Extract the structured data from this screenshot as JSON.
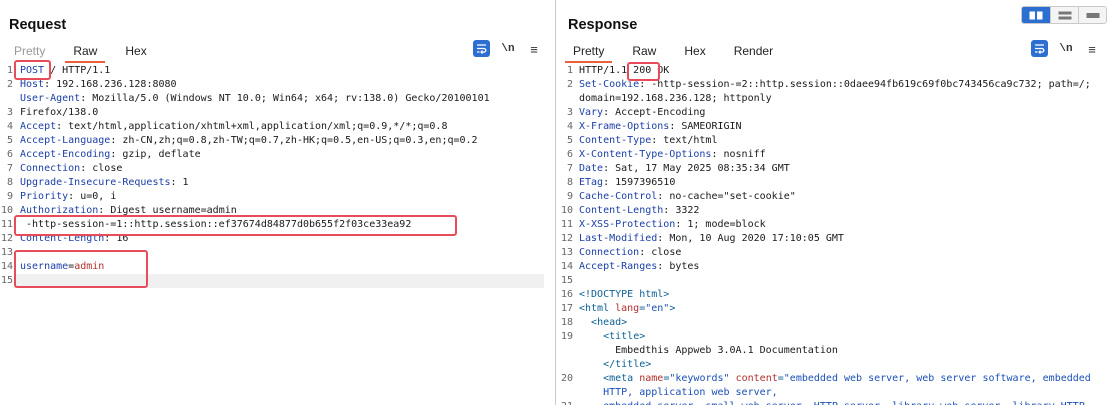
{
  "request": {
    "title": "Request",
    "tabs": [
      "Pretty",
      "Raw",
      "Hex"
    ],
    "active_tab": "Raw",
    "toolbar": {
      "wrap_icon": "wrap-lines-icon",
      "newline_label": "\\n",
      "menu_label": "≡"
    },
    "lines": [
      [
        [
          "k",
          "POST"
        ],
        [
          "v",
          " / HTTP/1.1"
        ]
      ],
      [
        [
          "k",
          "Host"
        ],
        [
          "v",
          ": 192.168.236.128:8080"
        ]
      ],
      [
        [
          "k",
          "User-Agent"
        ],
        [
          "v",
          ": Mozilla/5.0 (Windows NT 10.0; Win64; x64; rv:138.0) Gecko/20100101"
        ]
      ],
      [
        [
          "v",
          "Firefox/138.0"
        ]
      ],
      [
        [
          "k",
          "Accept"
        ],
        [
          "v",
          ": text/html,application/xhtml+xml,application/xml;q=0.9,*/*;q=0.8"
        ]
      ],
      [
        [
          "k",
          "Accept-Language"
        ],
        [
          "v",
          ": zh-CN,zh;q=0.8,zh-TW;q=0.7,zh-HK;q=0.5,en-US;q=0.3,en;q=0.2"
        ]
      ],
      [
        [
          "k",
          "Accept-Encoding"
        ],
        [
          "v",
          ": gzip, deflate"
        ]
      ],
      [
        [
          "k",
          "Connection"
        ],
        [
          "v",
          ": close"
        ]
      ],
      [
        [
          "k",
          "Upgrade-Insecure-Requests"
        ],
        [
          "v",
          ": 1"
        ]
      ],
      [
        [
          "k",
          "Priority"
        ],
        [
          "v",
          ": u=0, i"
        ]
      ],
      [
        [
          "k",
          "Authorization"
        ],
        [
          "v",
          ": Digest username=admin"
        ]
      ],
      [
        [
          "v",
          " -http-session-=1::http.session::ef37674d84877d0b655f2f03ce33ea92"
        ]
      ],
      [
        [
          "k",
          "Content-Length"
        ],
        [
          "v",
          ": 16"
        ]
      ],
      [],
      [
        [
          "k",
          "username"
        ],
        [
          "v",
          "="
        ],
        [
          "an",
          "admin"
        ]
      ],
      []
    ],
    "line_numbers": [
      "1",
      "2",
      "",
      "3",
      "4",
      "5",
      "6",
      "7",
      "8",
      "9",
      "10",
      "11",
      "12",
      "13",
      "14",
      "15"
    ]
  },
  "response": {
    "title": "Response",
    "tabs": [
      "Pretty",
      "Raw",
      "Hex",
      "Render"
    ],
    "active_tab": "Pretty",
    "toolbar": {
      "wrap_icon": "wrap-lines-icon",
      "newline_label": "\\n",
      "menu_label": "≡"
    },
    "lines": [
      [
        [
          "v",
          "HTTP/1.1 200 OK"
        ]
      ],
      [
        [
          "k",
          "Set-Cookie"
        ],
        [
          "v",
          ": -http-session-=2::http.session::0daee94fb619c69f0bc743456ca9c732; path=/;"
        ]
      ],
      [
        [
          "v",
          "domain=192.168.236.128; httponly"
        ]
      ],
      [
        [
          "k",
          "Vary"
        ],
        [
          "v",
          ": Accept-Encoding"
        ]
      ],
      [
        [
          "k",
          "X-Frame-Options"
        ],
        [
          "v",
          ": SAMEORIGIN"
        ]
      ],
      [
        [
          "k",
          "Content-Type"
        ],
        [
          "v",
          ": text/html"
        ]
      ],
      [
        [
          "k",
          "X-Content-Type-Options"
        ],
        [
          "v",
          ": nosniff"
        ]
      ],
      [
        [
          "k",
          "Date"
        ],
        [
          "v",
          ": Sat, 17 May 2025 08:35:34 GMT"
        ]
      ],
      [
        [
          "k",
          "ETag"
        ],
        [
          "v",
          ": 1597396510"
        ]
      ],
      [
        [
          "k",
          "Cache-Control"
        ],
        [
          "v",
          ": no-cache=\"set-cookie\""
        ]
      ],
      [
        [
          "k",
          "Content-Length"
        ],
        [
          "v",
          ": 3322"
        ]
      ],
      [
        [
          "k",
          "X-XSS-Protection"
        ],
        [
          "v",
          ": 1; mode=block"
        ]
      ],
      [
        [
          "k",
          "Last-Modified"
        ],
        [
          "v",
          ": Mon, 10 Aug 2020 17:10:05 GMT"
        ]
      ],
      [
        [
          "k",
          "Connection"
        ],
        [
          "v",
          ": close"
        ]
      ],
      [
        [
          "k",
          "Accept-Ranges"
        ],
        [
          "v",
          ": bytes"
        ]
      ],
      [],
      [
        [
          "tg",
          "<!DOCTYPE html>"
        ]
      ],
      [
        [
          "tg",
          "<html "
        ],
        [
          "an",
          "lang"
        ],
        [
          "tg",
          "="
        ],
        [
          "av",
          "\"en\""
        ],
        [
          "tg",
          ">"
        ]
      ],
      [
        [
          "t",
          "  "
        ],
        [
          "tg",
          "<head>"
        ]
      ],
      [
        [
          "t",
          "    "
        ],
        [
          "tg",
          "<title>"
        ]
      ],
      [
        [
          "t",
          "      Embedthis Appweb 3.0A.1 Documentation"
        ]
      ],
      [
        [
          "t",
          "    "
        ],
        [
          "tg",
          "</title>"
        ]
      ],
      [
        [
          "t",
          "    "
        ],
        [
          "tg",
          "<meta "
        ],
        [
          "an",
          "name"
        ],
        [
          "tg",
          "="
        ],
        [
          "av",
          "\"keywords\""
        ],
        [
          "tg",
          " "
        ],
        [
          "an",
          "content"
        ],
        [
          "tg",
          "="
        ],
        [
          "av",
          "\"embedded web server, web server software, embedded"
        ]
      ],
      [
        [
          "av",
          "    HTTP, application web server,"
        ]
      ],
      [
        [
          "av",
          "    embedded server, small web server, HTTP server, library web server, library HTTP"
        ]
      ]
    ],
    "line_numbers": [
      "1",
      "2",
      "",
      "3",
      "4",
      "5",
      "6",
      "7",
      "8",
      "9",
      "10",
      "11",
      "12",
      "13",
      "14",
      "15",
      "16",
      "17",
      "18",
      "19",
      "",
      "",
      "20",
      "",
      "21"
    ]
  },
  "layout_toggle": {
    "icons": [
      "side-by-side-icon",
      "top-bottom-icon",
      "tabbed-icon"
    ],
    "active_index": 0
  },
  "colors": {
    "accent": "#e8613c",
    "highlight": "#e84c5b",
    "button_blue": "#2d6fd0"
  }
}
